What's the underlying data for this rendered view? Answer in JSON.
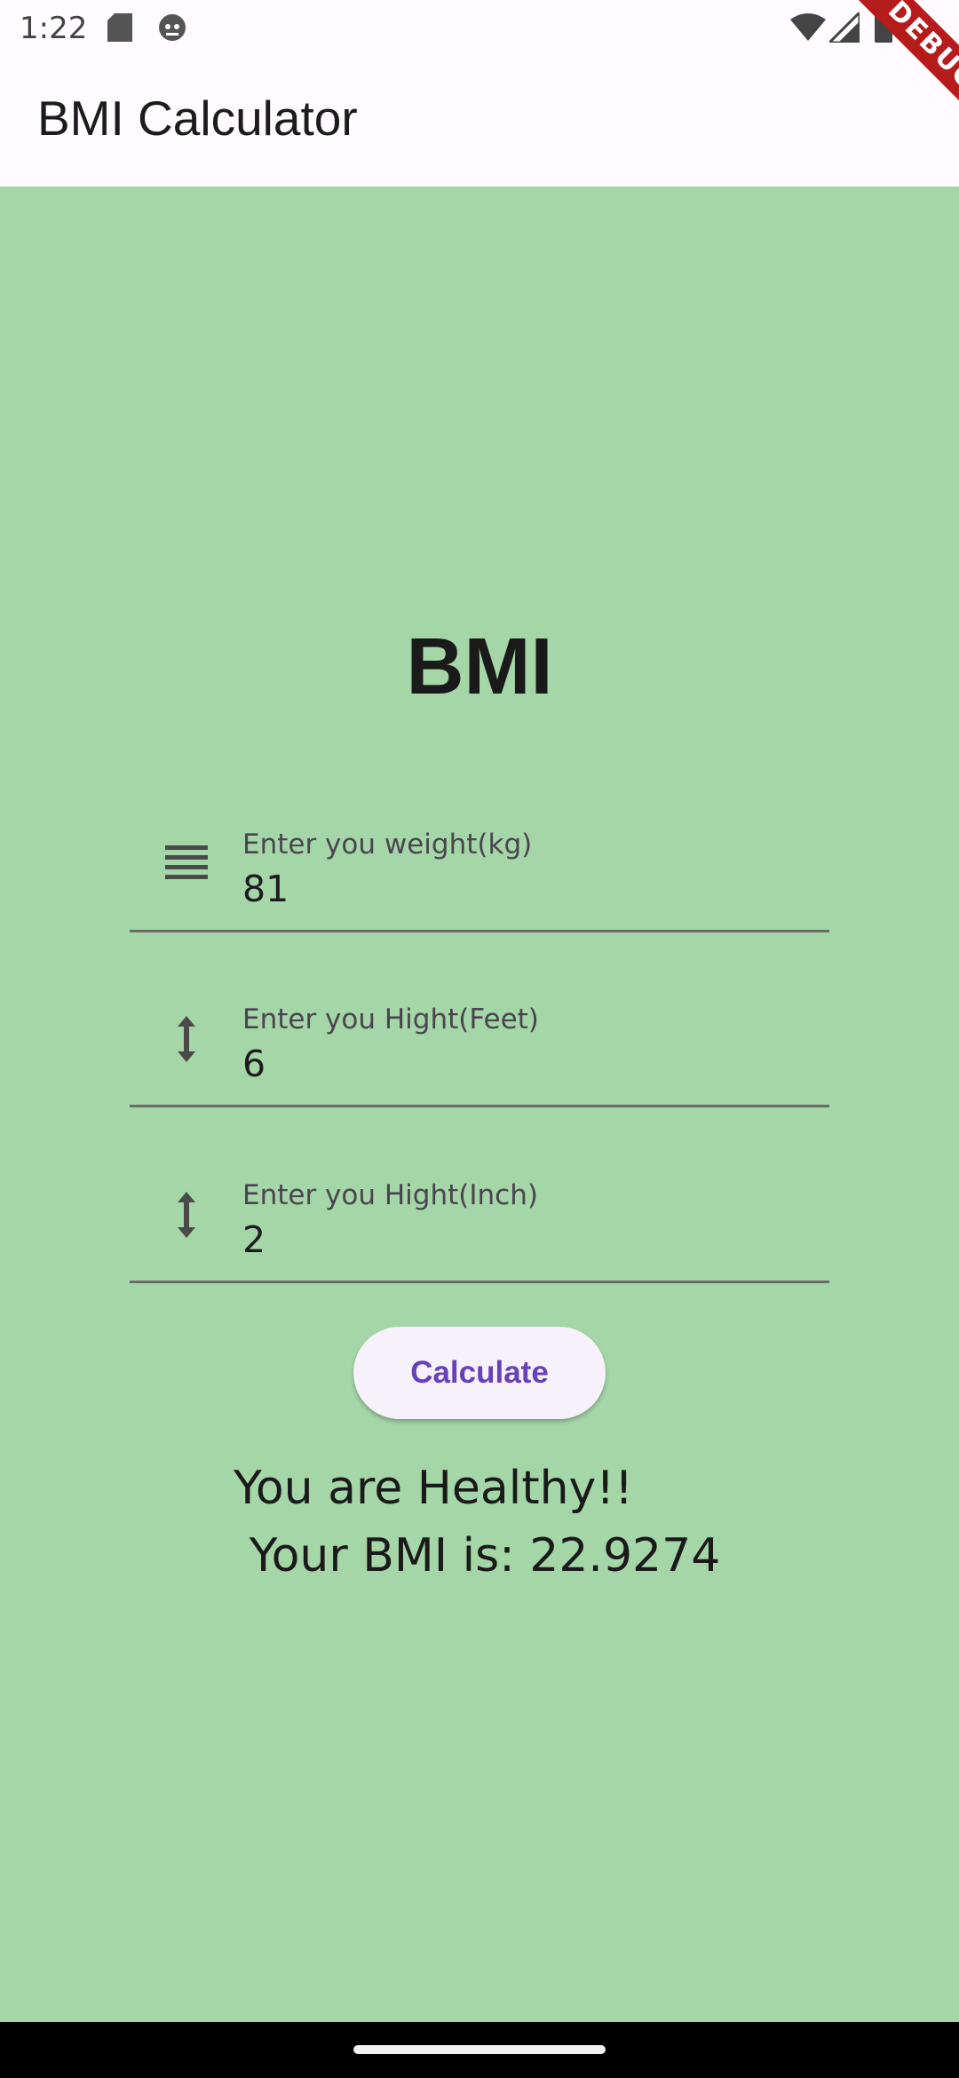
{
  "status_bar": {
    "time": "1:22",
    "icons": [
      "sd-card-icon",
      "android-robot-icon",
      "wifi-icon",
      "signal-icon",
      "battery-icon"
    ]
  },
  "app_bar": {
    "title": "BMI Calculator",
    "debug_banner": "DEBUG"
  },
  "main": {
    "heading": "BMI",
    "fields": {
      "weight": {
        "label": "Enter you weight(kg)",
        "value": "81",
        "icon": "weight-icon"
      },
      "feet": {
        "label": "Enter you Hight(Feet)",
        "value": "6",
        "icon": "height-arrows-icon"
      },
      "inch": {
        "label": "Enter you Hight(Inch)",
        "value": "2",
        "icon": "height-arrows-icon"
      }
    },
    "calculate_label": "Calculate",
    "result_status": "You are Healthy!!",
    "result_bmi": "Your BMI is: 22.9274"
  },
  "colors": {
    "background": "#a5d6a7",
    "app_bar": "#fffbfe",
    "button_text": "#6741b7",
    "debug_banner": "#b71c1c"
  }
}
